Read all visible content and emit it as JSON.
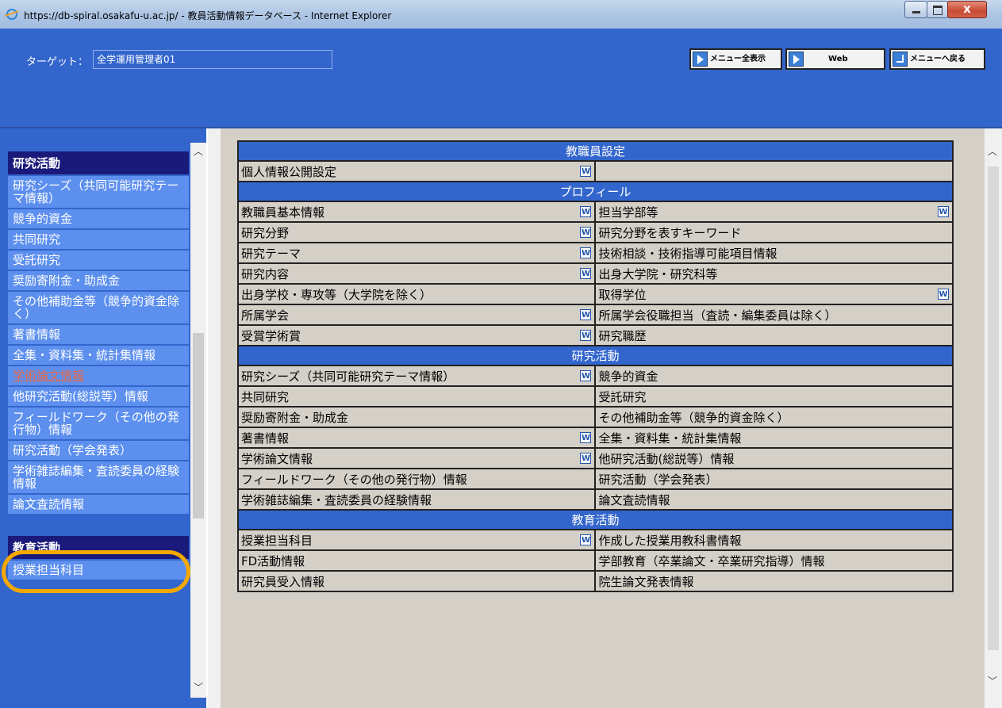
{
  "window": {
    "title": "https://db-spiral.osakafu-u.ac.jp/ - 教員活動情報データベース - Internet Explorer"
  },
  "header": {
    "target_label": "ターゲット：",
    "target_value": "全学運用管理者01",
    "buttons": {
      "menu_all": "メニュー全表示",
      "web": "Web",
      "menu_back": "メニューへ戻る"
    }
  },
  "sidebar": {
    "sections": [
      {
        "head": "研究活動",
        "items": [
          "研究シーズ（共同可能研究テーマ情報）",
          "競争的資金",
          "共同研究",
          "受託研究",
          "奨励寄附金・助成金",
          "その他補助金等（競争的資金除く）",
          "著書情報",
          "全集・資料集・統計集情報",
          "学術論文情報",
          "他研究活動(総説等）情報",
          "フィールドワーク（その他の発行物）情報",
          "研究活動（学会発表）",
          "学術雑誌編集・査読委員の経験情報",
          "論文査読情報"
        ],
        "highlighted": "学術論文情報"
      },
      {
        "head": "教育活動",
        "items": [
          "授業担当科目"
        ]
      }
    ]
  },
  "main": {
    "sections": [
      {
        "title": "教職員設定",
        "rows": [
          [
            {
              "label": "個人情報公開設定",
              "w": true
            },
            {
              "label": "",
              "w": false
            }
          ]
        ]
      },
      {
        "title": "プロフィール",
        "rows": [
          [
            {
              "label": "教職員基本情報",
              "w": true
            },
            {
              "label": "担当学部等",
              "w": true
            }
          ],
          [
            {
              "label": "研究分野",
              "w": true
            },
            {
              "label": "研究分野を表すキーワード",
              "w": false
            }
          ],
          [
            {
              "label": "研究テーマ",
              "w": true
            },
            {
              "label": "技術相談・技術指導可能項目情報",
              "w": false
            }
          ],
          [
            {
              "label": "研究内容",
              "w": true
            },
            {
              "label": "出身大学院・研究科等",
              "w": false
            }
          ],
          [
            {
              "label": "出身学校・専攻等（大学院を除く）",
              "w": false
            },
            {
              "label": "取得学位",
              "w": true
            }
          ],
          [
            {
              "label": "所属学会",
              "w": true
            },
            {
              "label": "所属学会役職担当（査読・編集委員は除く）",
              "w": false
            }
          ],
          [
            {
              "label": "受賞学術賞",
              "w": true
            },
            {
              "label": "研究職歴",
              "w": false
            }
          ]
        ]
      },
      {
        "title": "研究活動",
        "rows": [
          [
            {
              "label": "研究シーズ（共同可能研究テーマ情報）",
              "w": true
            },
            {
              "label": "競争的資金",
              "w": false
            }
          ],
          [
            {
              "label": "共同研究",
              "w": false
            },
            {
              "label": "受託研究",
              "w": false
            }
          ],
          [
            {
              "label": "奨励寄附金・助成金",
              "w": false
            },
            {
              "label": "その他補助金等（競争的資金除く）",
              "w": false
            }
          ],
          [
            {
              "label": "著書情報",
              "w": true
            },
            {
              "label": "全集・資料集・統計集情報",
              "w": false
            }
          ],
          [
            {
              "label": "学術論文情報",
              "w": true
            },
            {
              "label": "他研究活動(総説等）情報",
              "w": false
            }
          ],
          [
            {
              "label": "フィールドワーク（その他の発行物）情報",
              "w": false
            },
            {
              "label": "研究活動（学会発表）",
              "w": false
            }
          ],
          [
            {
              "label": "学術雑誌編集・査読委員の経験情報",
              "w": false
            },
            {
              "label": "論文査読情報",
              "w": false
            }
          ]
        ]
      },
      {
        "title": "教育活動",
        "rows": [
          [
            {
              "label": "授業担当科目",
              "w": true
            },
            {
              "label": "作成した授業用教科書情報",
              "w": false
            }
          ],
          [
            {
              "label": "FD活動情報",
              "w": false
            },
            {
              "label": "学部教育（卒業論文・卒業研究指導）情報",
              "w": false
            }
          ],
          [
            {
              "label": "研究員受入情報",
              "w": false
            },
            {
              "label": "院生論文発表情報",
              "w": false
            }
          ]
        ]
      }
    ],
    "w_icon_text": "W"
  }
}
